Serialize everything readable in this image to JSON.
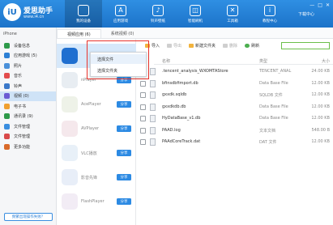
{
  "brand": {
    "title": "爱思助手",
    "url": "www.i4.cn",
    "badge": "iU"
  },
  "topnav": [
    {
      "label": "我的设备",
      "icon": "apple-icon",
      "glyph": ""
    },
    {
      "label": "应用游戏",
      "icon": "app-store-icon",
      "glyph": "A"
    },
    {
      "label": "铃声壁纸",
      "icon": "bell-icon",
      "glyph": "♪"
    },
    {
      "label": "智能刷机",
      "icon": "box-icon",
      "glyph": "◫"
    },
    {
      "label": "工具箱",
      "icon": "tools-icon",
      "glyph": "✕"
    },
    {
      "label": "教程中心",
      "icon": "info-icon",
      "glyph": "i"
    }
  ],
  "download_center": "下载中心",
  "window_controls": {
    "minimize": "—",
    "maximize": "□",
    "close": "✕"
  },
  "device_name": "iPhone",
  "sidebar": [
    {
      "label": "设备信息",
      "color": "#2e9a4a"
    },
    {
      "label": "应用游戏 (5)",
      "color": "#2c7fd4"
    },
    {
      "label": "照片",
      "color": "#4a90d9"
    },
    {
      "label": "音乐",
      "color": "#e24c4c"
    },
    {
      "label": "铃声",
      "color": "#3b78c9"
    },
    {
      "label": "视频 (0)",
      "color": "#6b5bd2"
    },
    {
      "label": "电子书",
      "color": "#f0a030"
    },
    {
      "label": "通讯录 (9)",
      "color": "#2e9a4a"
    },
    {
      "label": "文件管理",
      "color": "#3a8ee0"
    },
    {
      "label": "文件管理",
      "color": "#d94a4a"
    },
    {
      "label": "更多功能",
      "color": "#d96a2a"
    }
  ],
  "update_button": "频繁出现操作失败？",
  "tabs": [
    "视频应用 (6)",
    "系统视频 (0)"
  ],
  "apps": [
    {
      "name": "",
      "color": "#1f6fd0",
      "selected": true
    },
    {
      "name": "nPlayer",
      "color": "#e8edf2",
      "selected": false
    },
    {
      "name": "AcePlayer",
      "color": "#eef2e8",
      "selected": false
    },
    {
      "name": "AVPlayer",
      "color": "#f5e8ec",
      "selected": false
    },
    {
      "name": "VLC播放",
      "color": "#e8f0f8",
      "selected": false
    },
    {
      "name": "影音先锋",
      "color": "#e8eef8",
      "selected": false
    },
    {
      "name": "FlashPlayer",
      "color": "#f2ecf5",
      "selected": false
    }
  ],
  "share_label": "分享",
  "toolbar": {
    "import": "导入",
    "export": "导出",
    "new_folder": "新建文件夹",
    "delete": "删除",
    "refresh": "刷新",
    "search_placeholder": ""
  },
  "import_menu": [
    "选择文件",
    "选择文件夹"
  ],
  "table": {
    "headers": {
      "name": "名称",
      "type": "类型",
      "size": "大小"
    },
    "rows": [
      {
        "name": ".tencent_analysis_WXOMTAStore",
        "type": "TENCENT_ANAL",
        "size": "24.00 KB"
      },
      {
        "name": "bfinsdbfimport.db",
        "type": "Data Base File",
        "size": "12.00 KB"
      },
      {
        "name": "gxxdk.sqldb",
        "type": "SQLDB 文件",
        "size": "12.00 KB"
      },
      {
        "name": "gxxdkdb.db",
        "type": "Data Base File",
        "size": "12.00 KB"
      },
      {
        "name": "HyDataBase_v1.db",
        "type": "Data Base File",
        "size": "12.00 KB"
      },
      {
        "name": "PAAD.log",
        "type": "文本文档",
        "size": "548.00 B"
      },
      {
        "name": "PAAdCoreTrack.dat",
        "type": "DAT 文件",
        "size": "12.00 KB"
      }
    ]
  }
}
